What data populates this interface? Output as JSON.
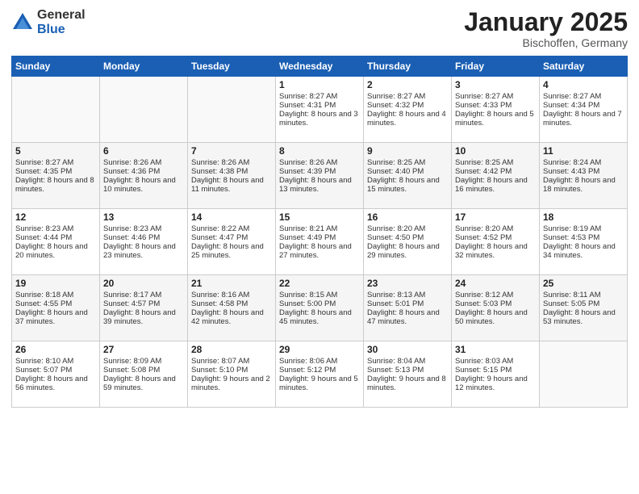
{
  "logo": {
    "general": "General",
    "blue": "Blue"
  },
  "header": {
    "title": "January 2025",
    "subtitle": "Bischoffen, Germany"
  },
  "days_of_week": [
    "Sunday",
    "Monday",
    "Tuesday",
    "Wednesday",
    "Thursday",
    "Friday",
    "Saturday"
  ],
  "weeks": [
    [
      {
        "day": "",
        "content": ""
      },
      {
        "day": "",
        "content": ""
      },
      {
        "day": "",
        "content": ""
      },
      {
        "day": "1",
        "content": "Sunrise: 8:27 AM\nSunset: 4:31 PM\nDaylight: 8 hours and 3 minutes."
      },
      {
        "day": "2",
        "content": "Sunrise: 8:27 AM\nSunset: 4:32 PM\nDaylight: 8 hours and 4 minutes."
      },
      {
        "day": "3",
        "content": "Sunrise: 8:27 AM\nSunset: 4:33 PM\nDaylight: 8 hours and 5 minutes."
      },
      {
        "day": "4",
        "content": "Sunrise: 8:27 AM\nSunset: 4:34 PM\nDaylight: 8 hours and 7 minutes."
      }
    ],
    [
      {
        "day": "5",
        "content": "Sunrise: 8:27 AM\nSunset: 4:35 PM\nDaylight: 8 hours and 8 minutes."
      },
      {
        "day": "6",
        "content": "Sunrise: 8:26 AM\nSunset: 4:36 PM\nDaylight: 8 hours and 10 minutes."
      },
      {
        "day": "7",
        "content": "Sunrise: 8:26 AM\nSunset: 4:38 PM\nDaylight: 8 hours and 11 minutes."
      },
      {
        "day": "8",
        "content": "Sunrise: 8:26 AM\nSunset: 4:39 PM\nDaylight: 8 hours and 13 minutes."
      },
      {
        "day": "9",
        "content": "Sunrise: 8:25 AM\nSunset: 4:40 PM\nDaylight: 8 hours and 15 minutes."
      },
      {
        "day": "10",
        "content": "Sunrise: 8:25 AM\nSunset: 4:42 PM\nDaylight: 8 hours and 16 minutes."
      },
      {
        "day": "11",
        "content": "Sunrise: 8:24 AM\nSunset: 4:43 PM\nDaylight: 8 hours and 18 minutes."
      }
    ],
    [
      {
        "day": "12",
        "content": "Sunrise: 8:23 AM\nSunset: 4:44 PM\nDaylight: 8 hours and 20 minutes."
      },
      {
        "day": "13",
        "content": "Sunrise: 8:23 AM\nSunset: 4:46 PM\nDaylight: 8 hours and 23 minutes."
      },
      {
        "day": "14",
        "content": "Sunrise: 8:22 AM\nSunset: 4:47 PM\nDaylight: 8 hours and 25 minutes."
      },
      {
        "day": "15",
        "content": "Sunrise: 8:21 AM\nSunset: 4:49 PM\nDaylight: 8 hours and 27 minutes."
      },
      {
        "day": "16",
        "content": "Sunrise: 8:20 AM\nSunset: 4:50 PM\nDaylight: 8 hours and 29 minutes."
      },
      {
        "day": "17",
        "content": "Sunrise: 8:20 AM\nSunset: 4:52 PM\nDaylight: 8 hours and 32 minutes."
      },
      {
        "day": "18",
        "content": "Sunrise: 8:19 AM\nSunset: 4:53 PM\nDaylight: 8 hours and 34 minutes."
      }
    ],
    [
      {
        "day": "19",
        "content": "Sunrise: 8:18 AM\nSunset: 4:55 PM\nDaylight: 8 hours and 37 minutes."
      },
      {
        "day": "20",
        "content": "Sunrise: 8:17 AM\nSunset: 4:57 PM\nDaylight: 8 hours and 39 minutes."
      },
      {
        "day": "21",
        "content": "Sunrise: 8:16 AM\nSunset: 4:58 PM\nDaylight: 8 hours and 42 minutes."
      },
      {
        "day": "22",
        "content": "Sunrise: 8:15 AM\nSunset: 5:00 PM\nDaylight: 8 hours and 45 minutes."
      },
      {
        "day": "23",
        "content": "Sunrise: 8:13 AM\nSunset: 5:01 PM\nDaylight: 8 hours and 47 minutes."
      },
      {
        "day": "24",
        "content": "Sunrise: 8:12 AM\nSunset: 5:03 PM\nDaylight: 8 hours and 50 minutes."
      },
      {
        "day": "25",
        "content": "Sunrise: 8:11 AM\nSunset: 5:05 PM\nDaylight: 8 hours and 53 minutes."
      }
    ],
    [
      {
        "day": "26",
        "content": "Sunrise: 8:10 AM\nSunset: 5:07 PM\nDaylight: 8 hours and 56 minutes."
      },
      {
        "day": "27",
        "content": "Sunrise: 8:09 AM\nSunset: 5:08 PM\nDaylight: 8 hours and 59 minutes."
      },
      {
        "day": "28",
        "content": "Sunrise: 8:07 AM\nSunset: 5:10 PM\nDaylight: 9 hours and 2 minutes."
      },
      {
        "day": "29",
        "content": "Sunrise: 8:06 AM\nSunset: 5:12 PM\nDaylight: 9 hours and 5 minutes."
      },
      {
        "day": "30",
        "content": "Sunrise: 8:04 AM\nSunset: 5:13 PM\nDaylight: 9 hours and 8 minutes."
      },
      {
        "day": "31",
        "content": "Sunrise: 8:03 AM\nSunset: 5:15 PM\nDaylight: 9 hours and 12 minutes."
      },
      {
        "day": "",
        "content": ""
      }
    ]
  ]
}
